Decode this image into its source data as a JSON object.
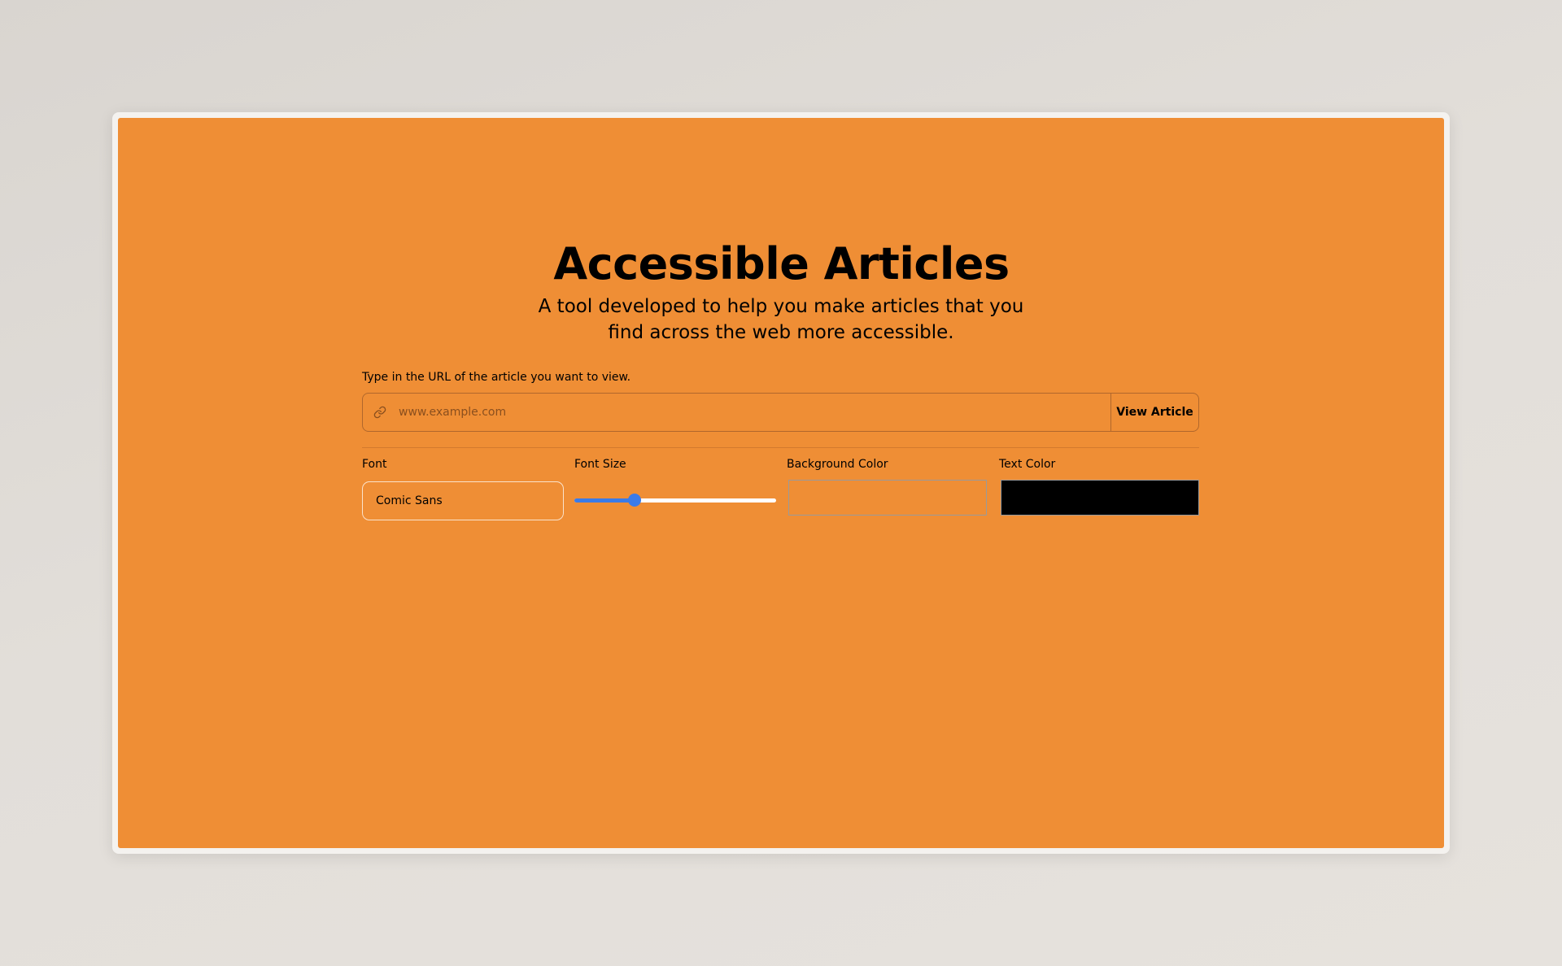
{
  "header": {
    "title": "Accessible Articles",
    "subtitle": "A tool developed to help you make articles that you find across the web more accessible."
  },
  "url_form": {
    "label": "Type in the URL of the article you want to view.",
    "placeholder": "www.example.com",
    "value": "",
    "icon": "link-icon",
    "submit_label": "View Article"
  },
  "settings": {
    "font": {
      "label": "Font",
      "selected": "Comic Sans"
    },
    "font_size": {
      "label": "Font Size",
      "value_fraction": 0.3
    },
    "background_color": {
      "label": "Background Color",
      "value": "#ef8e35"
    },
    "text_color": {
      "label": "Text Color",
      "value": "#000000"
    }
  },
  "colors": {
    "page_background": "#ef8e35",
    "accent": "#3b7be8"
  }
}
